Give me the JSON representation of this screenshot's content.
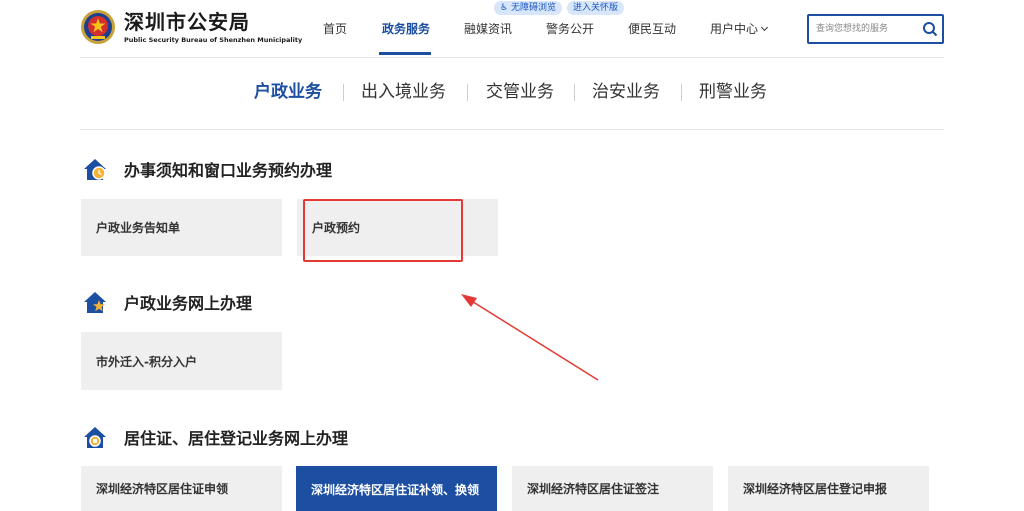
{
  "header": {
    "logo_cn": "深圳市公安局",
    "logo_en": "Public Security Bureau of Shenzhen Municipality",
    "accessibility": [
      "无障碍浏览",
      "进入关怀版"
    ],
    "nav": [
      "首页",
      "政务服务",
      "融媒资讯",
      "警务公开",
      "便民互动",
      "用户中心"
    ],
    "active_nav": "政务服务",
    "search_placeholder": "查询您想找的服务"
  },
  "tabs": [
    "户政业务",
    "出入境业务",
    "交管业务",
    "治安业务",
    "刑警业务"
  ],
  "active_tab": "户政业务",
  "sections": [
    {
      "title": "办事须知和窗口业务预约办理",
      "cards": [
        "户政业务告知单",
        "户政预约"
      ]
    },
    {
      "title": "户政业务网上办理",
      "cards": [
        "市外迁入-积分入户"
      ]
    },
    {
      "title": "居住证、居住登记业务网上办理",
      "cards": [
        "深圳经济特区居住证申领",
        "深圳经济特区居住证补领、换领",
        "深圳经济特区居住证签注",
        "深圳经济特区居住登记申报"
      ]
    }
  ],
  "colors": {
    "brand": "#1c4ea2",
    "annotation": "#e53935",
    "card_bg": "#efefef"
  }
}
